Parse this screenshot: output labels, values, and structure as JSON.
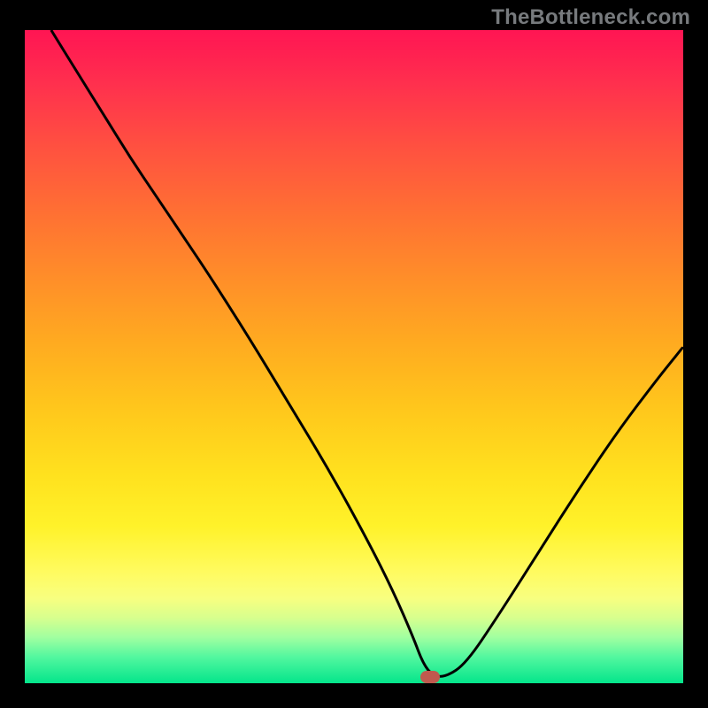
{
  "watermark": {
    "text": "TheBottleneck.com"
  },
  "chart_data": {
    "type": "line",
    "title": "",
    "xlabel": "",
    "ylabel": "",
    "xlim": [
      0,
      100
    ],
    "ylim": [
      0,
      100
    ],
    "grid": false,
    "series": [
      {
        "name": "bottleneck-curve",
        "x": [
          4,
          8,
          12,
          16,
          20,
          24,
          28,
          34,
          40,
          46,
          52,
          56,
          59,
          60.5,
          62,
          64,
          67,
          72,
          78,
          84,
          90,
          96,
          100
        ],
        "y": [
          100,
          93.5,
          87,
          80.5,
          74.5,
          68.5,
          62.5,
          53,
          43,
          33,
          22,
          14,
          7,
          3,
          1.1,
          1,
          3,
          10.5,
          20,
          29.5,
          38.5,
          46.5,
          51.5
        ]
      }
    ],
    "marker": {
      "name": "optimum-point",
      "x": 61.5,
      "y": 1
    },
    "background": "red-yellow-green vertical gradient",
    "legend": false
  },
  "colors": {
    "curve_stroke": "#000000",
    "marker_fill": "#c0594e",
    "frame": "#000000",
    "watermark_text": "#777a7d"
  }
}
